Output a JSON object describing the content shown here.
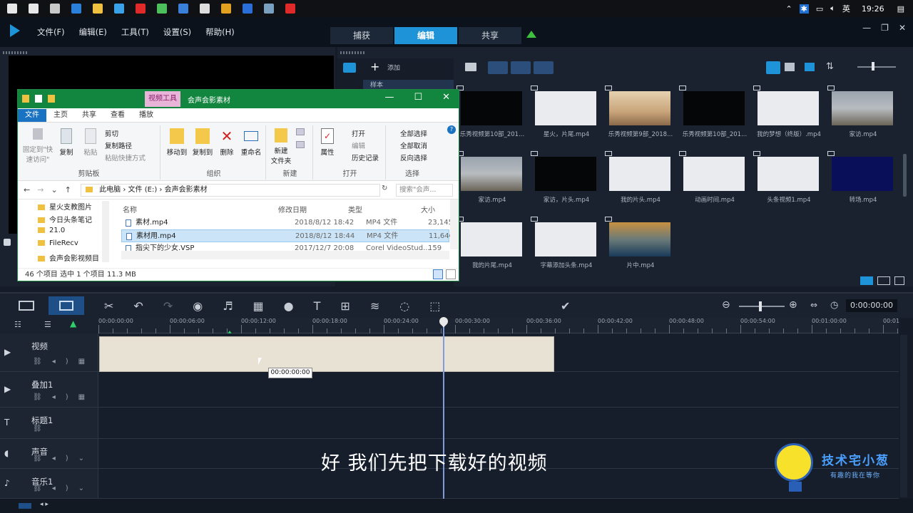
{
  "taskbar": {
    "icons": [
      "windows-icon",
      "chat-icon",
      "task-view-icon",
      "edge-icon",
      "file-explorer-icon",
      "store-icon",
      "opera-icon",
      "green-app-icon",
      "app-icon",
      "mail-icon",
      "chrome-icon",
      "media-icon",
      "notes-icon",
      "record-icon"
    ],
    "tray": {
      "input_lang": "英",
      "time": "19:26"
    }
  },
  "menu": {
    "items": [
      "文件(F)",
      "编辑(E)",
      "工具(T)",
      "设置(S)",
      "帮助(H)"
    ]
  },
  "mode_tabs": [
    "捕获",
    "编辑",
    "共享"
  ],
  "library": {
    "add_label": "添加",
    "side_item": "样本",
    "thumbnails": [
      {
        "caption": "乐秀视频第10部_201...",
        "style": "black"
      },
      {
        "caption": "星火，片尾.mp4",
        "style": "white"
      },
      {
        "caption": "乐秀视频第9部_2018...",
        "style": "photo"
      },
      {
        "caption": "乐秀视频第10部_201...",
        "style": "black"
      },
      {
        "caption": "我的梦想（终版）.mp4",
        "style": "white"
      },
      {
        "caption": "家访.mp4",
        "style": "road"
      },
      {
        "caption": "家访.mp4",
        "style": "road"
      },
      {
        "caption": "家访，片头.mp4",
        "style": "black"
      },
      {
        "caption": "我的片头.mp4",
        "style": "white"
      },
      {
        "caption": "动画时间.mp4",
        "style": "white"
      },
      {
        "caption": "头条视频1.mp4",
        "style": "white"
      },
      {
        "caption": "转场.mp4",
        "style": "navy"
      },
      {
        "caption": "我的片尾.mp4",
        "style": "white"
      },
      {
        "caption": "字幕添加头条.mp4",
        "style": "white"
      },
      {
        "caption": "片中.mp4",
        "style": "coast"
      }
    ]
  },
  "explorer": {
    "context_tab": "视频工具",
    "title": "会声会影素材",
    "ribbon_tabs": [
      "文件",
      "主页",
      "共享",
      "查看",
      "播放"
    ],
    "ribbon": {
      "pin": "固定到\"快速访问\"",
      "copy": "复制",
      "paste": "粘贴",
      "cut": "剪切",
      "copy_path": "复制路径",
      "paste_shortcut": "粘贴快捷方式",
      "clipboard_group": "剪贴板",
      "move_to": "移动到",
      "copy_to": "复制到",
      "delete": "删除",
      "rename": "重命名",
      "organize_group": "组织",
      "new_folder": "新建\n文件夹",
      "new_group": "新建",
      "properties": "属性",
      "open": "打开",
      "edit": "编辑",
      "history": "历史记录",
      "open_group": "打开",
      "select_all": "全部选择",
      "select_none": "全部取消",
      "invert": "反向选择",
      "select_group": "选择"
    },
    "address": {
      "parts": [
        "此电脑",
        "文件 (E:)",
        "会声会影素材"
      ],
      "search_placeholder": "搜索\"会声..."
    },
    "nav": [
      "星火支教图片",
      "今日头条笔记",
      "21.0",
      "FileRecv",
      "会声会影视频目"
    ],
    "columns": [
      "名称",
      "修改日期",
      "类型",
      "大小"
    ],
    "files": [
      {
        "name": "素材.mp4",
        "date": "2018/8/12 18:42",
        "type": "MP4 文件",
        "size": "23,145",
        "selected": false
      },
      {
        "name": "素材用.mp4",
        "date": "2018/8/12 18:44",
        "type": "MP4 文件",
        "size": "11,646",
        "selected": true
      },
      {
        "name": "指尖下的少女.VSP",
        "date": "2017/12/7 20:08",
        "type": "Corel VideoStud...",
        "size": "159",
        "selected": false
      }
    ],
    "status": "46 个项目    选中 1 个项目  11.3 MB"
  },
  "timeline": {
    "timecode": "0:00:00:00",
    "ruler_ticks": [
      "00:00:00:00",
      "00:00:06:00",
      "00:00:12:00",
      "00:00:18:00",
      "00:00:24:00",
      "00:00:30:00",
      "00:00:36:00",
      "00:00:42:00",
      "00:00:48:00",
      "00:00:54:00",
      "00:01:00:00",
      "00:01"
    ],
    "tracks": [
      "视频",
      "叠加1",
      "标题1",
      "声音",
      "音乐1"
    ],
    "tooltip": "00:00:00:00",
    "subtitle": "好 我们先把下载好的视频"
  },
  "logo": {
    "title": "技术宅小葱",
    "tagline": "有趣的我在等你"
  },
  "colors": {
    "accent": "#1e93d8",
    "explorer_green": "#12853f",
    "clip": "#e8e2d4"
  }
}
